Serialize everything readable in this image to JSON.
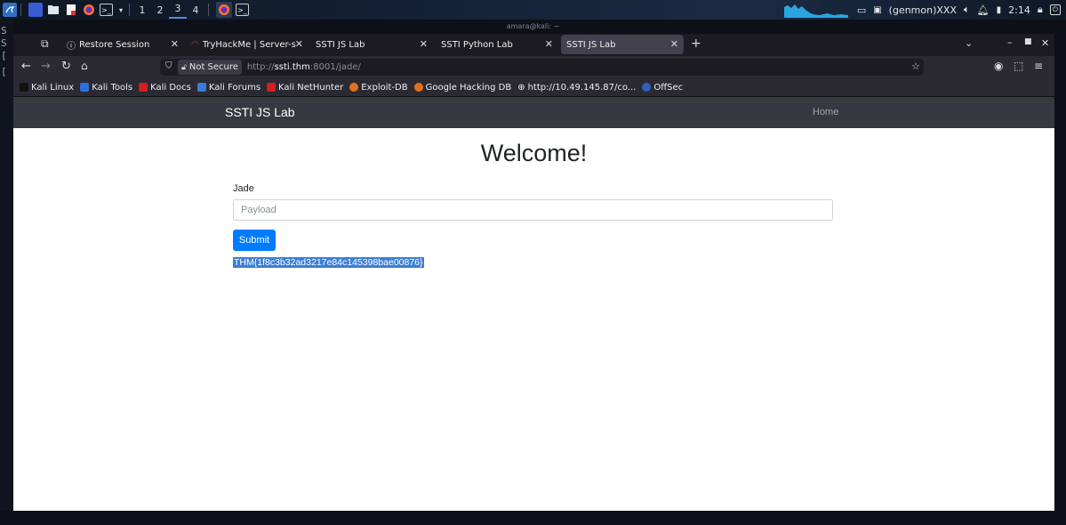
{
  "taskbar": {
    "workspaces": [
      "1",
      "2",
      "3",
      "4"
    ],
    "active_workspace": "3",
    "genmon": "(genmon)XXX",
    "time": "2:14"
  },
  "window": {
    "title": "amara@kali: ~"
  },
  "terminal_side": {
    "line1": "S",
    "line2": "[",
    "line3": "["
  },
  "browser": {
    "tabs": [
      {
        "label": "Restore Session",
        "icon": "info-icon"
      },
      {
        "label": "TryHackMe | Server-side Te",
        "icon": "thm-icon"
      },
      {
        "label": "SSTI JS Lab",
        "icon": ""
      },
      {
        "label": "SSTI Python Lab",
        "icon": ""
      },
      {
        "label": "SSTI JS Lab",
        "icon": "",
        "active": true
      }
    ],
    "address": {
      "security": "Not Secure",
      "url_prefix": "http://",
      "url_host": "ssti.thm",
      "url_rest": ":8001/jade/"
    },
    "bookmarks": [
      {
        "label": "Kali Linux",
        "color": "#111111"
      },
      {
        "label": "Kali Tools",
        "color": "#2d6fd6"
      },
      {
        "label": "Kali Docs",
        "color": "#d02020"
      },
      {
        "label": "Kali Forums",
        "color": "#3a7bd5"
      },
      {
        "label": "Kali NetHunter",
        "color": "#d02020"
      },
      {
        "label": "Exploit-DB",
        "color": "#e07020"
      },
      {
        "label": "Google Hacking DB",
        "color": "#e07020"
      },
      {
        "label": "http://10.49.145.87/co...",
        "color": "#cccccc"
      },
      {
        "label": "OffSec",
        "color": "#3060c0"
      }
    ]
  },
  "page": {
    "brand": "SSTI JS Lab",
    "nav_home": "Home",
    "heading": "Welcome!",
    "field_label": "Jade",
    "input_placeholder": "Payload",
    "submit_label": "Submit",
    "result": "THM{1f8c3b32ad3217e84c145398bae00876}"
  }
}
